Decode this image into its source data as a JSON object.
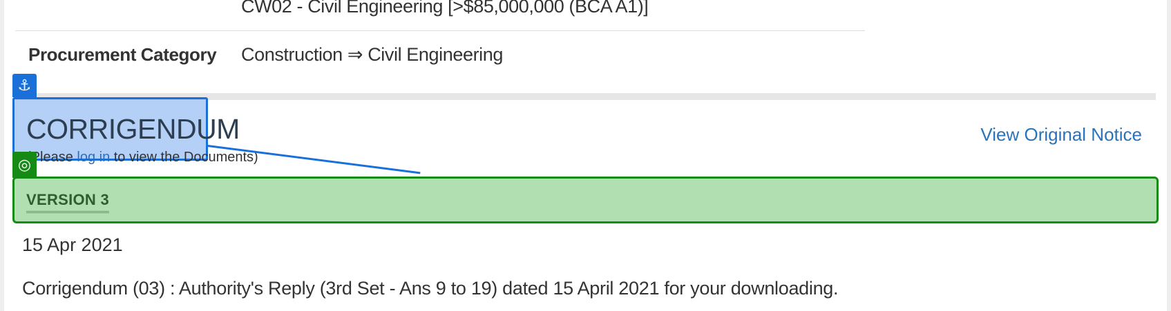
{
  "details": {
    "grade_value": "CW02 - Civil Engineering [>$85,000,000 (BCA A1)]",
    "procurement_category_label": "Procurement Category",
    "procurement_category_value": "Construction ⇒ Civil Engineering"
  },
  "corrigendum": {
    "title": "CORRIGENDUM",
    "login_prefix": "(Please ",
    "login_link": "log in",
    "login_suffix": " to view the Documents)",
    "view_original_label": "View Original Notice"
  },
  "version": {
    "label": "VERSION 3",
    "date": "15 Apr 2021",
    "description": "Corrigendum (03) : Authority's Reply (3rd Set - Ans 9 to 19) dated 15 April 2021 for your downloading."
  },
  "colors": {
    "highlight_blue": "#1a6fd8",
    "highlight_green": "#158a15",
    "link": "#2a73b8"
  },
  "icons": {
    "anchor_badge": "anchor-icon",
    "target_badge": "target-icon"
  }
}
